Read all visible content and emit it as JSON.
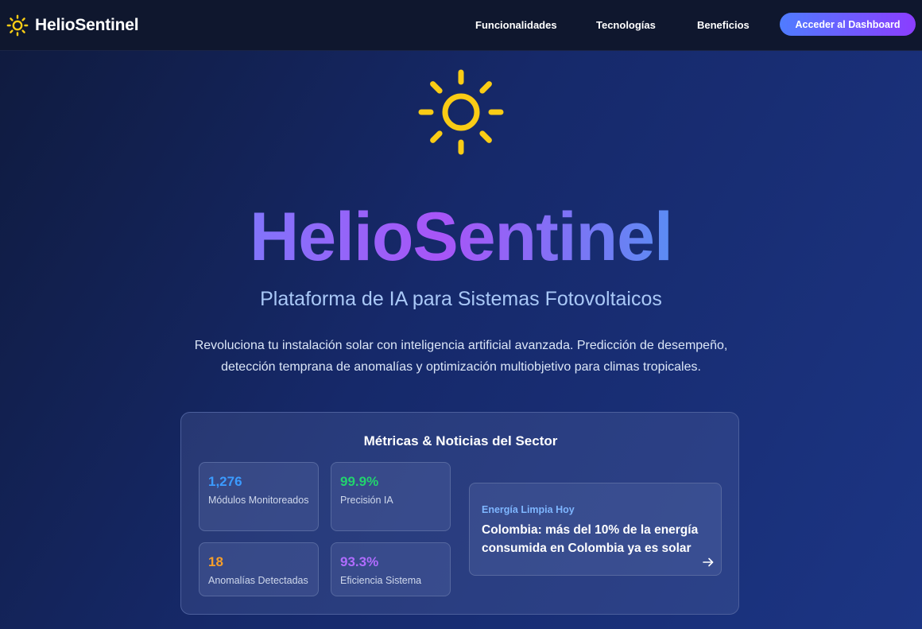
{
  "nav": {
    "brand": "HelioSentinel",
    "links": [
      "Funcionalidades",
      "Tecnologías",
      "Beneficios"
    ],
    "cta": "Acceder al Dashboard"
  },
  "hero": {
    "icon": "sun-icon",
    "title": "HelioSentinel",
    "subtitle": "Plataforma de IA para Sistemas Fotovoltaicos",
    "description": "Revoluciona tu instalación solar con inteligencia artificial avanzada. Predicción de desempeño, detección temprana de anomalías y optimización multiobjetivo para climas tropicales."
  },
  "panel": {
    "title": "Métricas & Noticias del Sector",
    "metrics": [
      {
        "value": "1,276",
        "label": "Módulos Monitoreados",
        "color": "#3b9bff"
      },
      {
        "value": "99.9%",
        "label": "Precisión IA",
        "color": "#22d36e"
      },
      {
        "value": "18",
        "label": "Anomalías Detectadas",
        "color": "#f59e2a"
      },
      {
        "value": "93.3%",
        "label": "Eficiencia Sistema",
        "color": "#b06cff"
      }
    ],
    "news": {
      "source": "Energía Limpia Hoy",
      "headline": "Colombia: más del 10% de la energía consumida en Colombia ya es solar",
      "icon": "arrow-right-icon"
    }
  },
  "colors": {
    "accent_yellow": "#facc15",
    "cta_gradient_start": "#4f7cff",
    "cta_gradient_end": "#8b3dff"
  }
}
